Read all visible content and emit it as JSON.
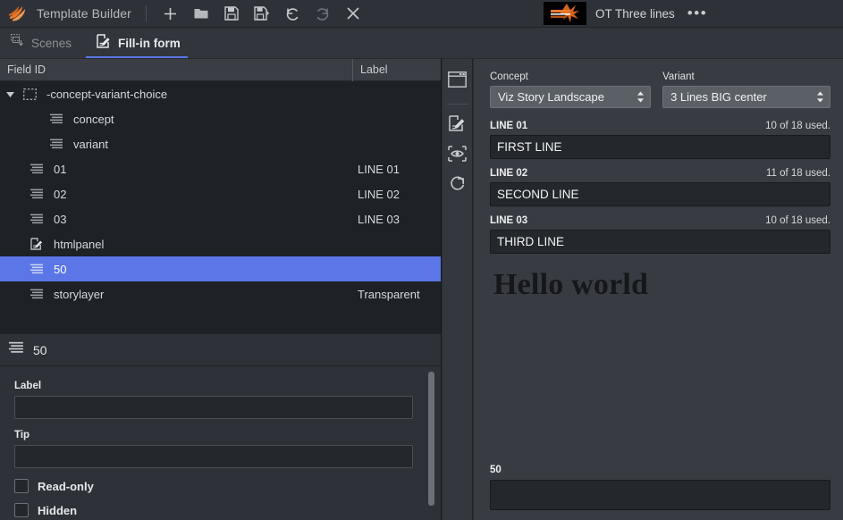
{
  "app": {
    "title": "Template Builder",
    "logo_icon": "viz-flame-logo-icon"
  },
  "toolbar": {
    "buttons": [
      {
        "name": "new",
        "icon": "plus-icon"
      },
      {
        "name": "open",
        "icon": "folder-icon"
      },
      {
        "name": "save",
        "icon": "save-icon"
      },
      {
        "name": "save-as",
        "icon": "save-as-icon"
      },
      {
        "name": "undo",
        "icon": "undo-icon"
      },
      {
        "name": "redo",
        "icon": "redo-icon"
      },
      {
        "name": "close",
        "icon": "close-icon"
      }
    ]
  },
  "document": {
    "name": "OT Three lines",
    "more_label": "•••",
    "thumbnail_icon": "template-thumbnail"
  },
  "tabs": [
    {
      "label": "Scenes",
      "icon": "scenes-icon",
      "active": false
    },
    {
      "label": "Fill-in form",
      "icon": "fill-in-form-icon",
      "active": true
    }
  ],
  "tree": {
    "columns": {
      "field_id": "Field ID",
      "label": "Label"
    },
    "rows": [
      {
        "field_id": "-concept-variant-choice",
        "label": "",
        "icon": "group-icon",
        "indent": 0,
        "twisty": "expanded",
        "selected": false
      },
      {
        "field_id": "concept",
        "label": "",
        "icon": "text-field-icon",
        "indent": 2,
        "twisty": "",
        "selected": false
      },
      {
        "field_id": "variant",
        "label": "",
        "icon": "text-field-icon",
        "indent": 2,
        "twisty": "",
        "selected": false
      },
      {
        "field_id": "01",
        "label": "LINE 01",
        "icon": "text-field-icon",
        "indent": 1,
        "twisty": "",
        "selected": false
      },
      {
        "field_id": "02",
        "label": "LINE 02",
        "icon": "text-field-icon",
        "indent": 1,
        "twisty": "",
        "selected": false
      },
      {
        "field_id": "03",
        "label": "LINE 03",
        "icon": "text-field-icon",
        "indent": 1,
        "twisty": "",
        "selected": false
      },
      {
        "field_id": "htmlpanel",
        "label": "",
        "icon": "html-panel-icon",
        "indent": 1,
        "twisty": "",
        "selected": false
      },
      {
        "field_id": "50",
        "label": "",
        "icon": "text-field-icon",
        "indent": 1,
        "twisty": "",
        "selected": true
      },
      {
        "field_id": "storylayer",
        "label": "Transparent",
        "icon": "text-field-icon",
        "indent": 1,
        "twisty": "",
        "selected": false
      }
    ]
  },
  "properties": {
    "header_title": "50",
    "header_icon": "text-field-icon",
    "label_caption": "Label",
    "label_value": "",
    "tip_caption": "Tip",
    "tip_value": "",
    "readonly_caption": "Read-only",
    "readonly_checked": false,
    "hidden_caption": "Hidden",
    "hidden_checked": false
  },
  "rail": {
    "buttons": [
      {
        "name": "panel-layout",
        "icon": "window-panel-icon"
      },
      {
        "name": "edit-form",
        "icon": "edit-pencil-icon"
      },
      {
        "name": "preview",
        "icon": "eye-preview-icon"
      },
      {
        "name": "refresh",
        "icon": "refresh-icon"
      }
    ]
  },
  "form": {
    "concept": {
      "caption": "Concept",
      "value": "Viz Story Landscape",
      "arrow_icon": "updown-arrow-icon"
    },
    "variant": {
      "caption": "Variant",
      "value": "3 Lines BIG center",
      "arrow_icon": "updown-arrow-icon"
    },
    "fields": [
      {
        "name": "LINE 01",
        "counter": "10 of 18 used.",
        "value": "FIRST LINE"
      },
      {
        "name": "LINE 02",
        "counter": "11 of 18 used.",
        "value": "SECOND LINE"
      },
      {
        "name": "LINE 03",
        "counter": "10 of 18 used.",
        "value": "THIRD LINE"
      }
    ],
    "html_panel": {
      "text": "Hello world"
    },
    "bottom_field": {
      "name": "50",
      "value": ""
    }
  },
  "colors": {
    "accent_blue": "#5b76e6",
    "brand_orange": "#e8792a",
    "panel_bg": "#383c42",
    "tree_bg": "#1e2126",
    "input_bg": "#24272c"
  }
}
